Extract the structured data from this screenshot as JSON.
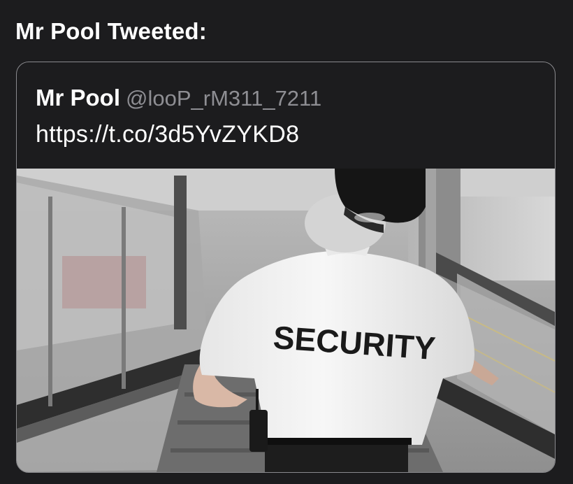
{
  "header": {
    "title": "Mr Pool Tweeted:"
  },
  "tweet": {
    "author_name": "Mr Pool",
    "author_handle": "@looP_rM311_7211",
    "link_text": "https://t.co/3d5YvZYKD8",
    "image": {
      "shirt_text": "SECURITY"
    }
  }
}
